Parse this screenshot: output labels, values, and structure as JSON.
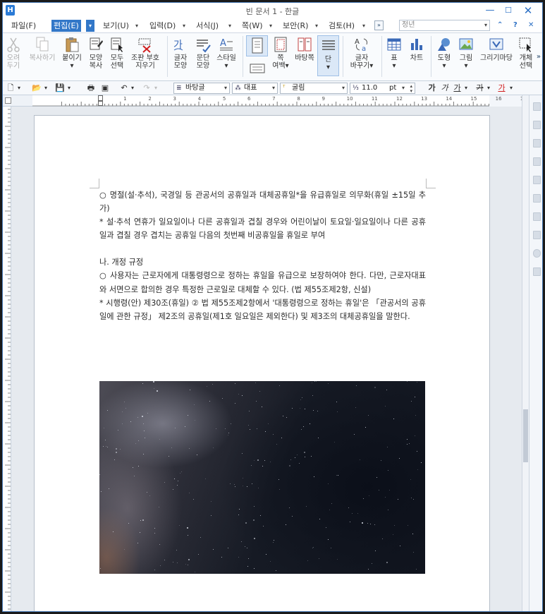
{
  "window": {
    "title": "빈 문서 1 - 한글",
    "app_icon_letter": "H",
    "minimize": "—",
    "maximize": "☐",
    "close": "✕"
  },
  "menu": {
    "items": [
      {
        "label": "파일(F)",
        "active": false
      },
      {
        "label": "편집(E)",
        "active": true
      },
      {
        "label": "보기(U)",
        "active": false
      },
      {
        "label": "입력(D)",
        "active": false
      },
      {
        "label": "서식(J)",
        "active": false
      },
      {
        "label": "쪽(W)",
        "active": false
      },
      {
        "label": "보안(R)",
        "active": false
      },
      {
        "label": "검토(H)",
        "active": false
      }
    ],
    "more_glyph": "»",
    "style_search_placeholder": "정년",
    "help_glyphs": [
      "⌃",
      "?",
      "✕"
    ]
  },
  "ribbon": {
    "buttons": [
      {
        "label1": "오려",
        "label2": "두기",
        "disabled": true
      },
      {
        "label1": "복사하기",
        "label2": "",
        "disabled": true
      },
      {
        "label1": "붙이기",
        "label2": "▾",
        "disabled": false
      },
      {
        "label1": "모양",
        "label2": "복사",
        "disabled": false
      },
      {
        "label1": "모두",
        "label2": "선택",
        "disabled": false
      },
      {
        "label1": "조판 부호",
        "label2": "지우기",
        "disabled": false
      },
      {
        "label1": "글자",
        "label2": "모양",
        "disabled": false
      },
      {
        "label1": "문단",
        "label2": "모양",
        "disabled": false
      },
      {
        "label1": "스타일",
        "label2": "▾",
        "disabled": false
      },
      {
        "label1": "쪽",
        "label2": "여백▾",
        "disabled": false
      },
      {
        "label1": "바탕쪽",
        "label2": "",
        "disabled": false
      },
      {
        "label1": "단",
        "label2": "▾",
        "disabled": false
      },
      {
        "label1": "글자",
        "label2": "바꾸기▾",
        "disabled": false
      },
      {
        "label1": "표",
        "label2": "▾",
        "disabled": false
      },
      {
        "label1": "차트",
        "label2": "",
        "disabled": false
      },
      {
        "label1": "도형",
        "label2": "▾",
        "disabled": false
      },
      {
        "label1": "그림",
        "label2": "▾",
        "disabled": false
      },
      {
        "label1": "그리기마당",
        "label2": "",
        "disabled": false
      },
      {
        "label1": "개체",
        "label2": "선택",
        "disabled": false
      }
    ],
    "more_glyph": "»"
  },
  "format_bar": {
    "style_value": "바탕글",
    "font_lang_value": "대표",
    "font_value": "굴림",
    "size_value": "11.0",
    "size_unit": "pt",
    "bold_glyph": "가",
    "italic_glyph": "가",
    "underline_glyph": "가",
    "strike_glyph": "가",
    "color_glyph": "가"
  },
  "ruler": {
    "ticks": [
      "1",
      "2",
      "3",
      "4",
      "5",
      "6",
      "7",
      "8",
      "9",
      "10",
      "11",
      "12",
      "13",
      "14",
      "15",
      "16",
      "17",
      "18"
    ]
  },
  "document": {
    "paragraphs": [
      "○ 명절(설·추석), 국경일 등 관공서의 공휴일과 대체공휴일*을 유급휴일로 의무화(휴일 ±15일 추가)",
      "* 설·추석 연휴가 일요일이나 다른 공휴일과 겹칠 경우와 어린이날이 토요일·일요일이나 다른 공휴일과 겹칠 경우 겹치는 공휴일 다음의 첫번째 비공휴일을 휴일로 부여",
      "",
      "나. 개정 규정",
      "○ 사용자는 근로자에게 대통령령으로 정하는 휴일을 유급으로 보장하여야 한다. 다만, 근로자대표와 서면으로 합의한 경우 특정한 근로일로 대체할 수 있다. (법 제55조제2항, 신설)",
      "* 시행령(안) 제30조(휴일) ② 법 제55조제2항에서 '대통령령으로 정하는 휴일'은 「관공서의 공휴일에 관한 규정」 제2조의 공휴일(제1호 일요일은 제외한다) 및 제3조의 대체공휴일을 말한다."
    ]
  }
}
